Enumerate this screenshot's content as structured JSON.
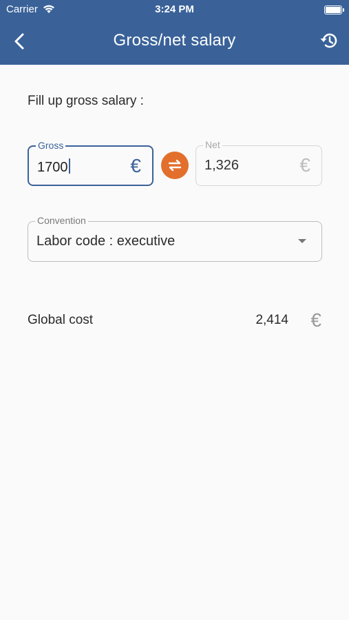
{
  "status_bar": {
    "carrier": "Carrier",
    "time": "3:24 PM"
  },
  "header": {
    "title": "Gross/net salary",
    "back_icon": "chevron-left-icon",
    "reset_icon": "history-reset-icon",
    "background": "#3a6299"
  },
  "form": {
    "prompt": "Fill up gross salary :",
    "gross": {
      "label": "Gross",
      "value": "1700",
      "currency": "€"
    },
    "swap_icon": "swap-arrows-icon",
    "swap_color": "#e36f2c",
    "net": {
      "label": "Net",
      "value": "1,326",
      "currency": "€"
    },
    "convention": {
      "label": "Convention",
      "value": "Labor code : executive"
    }
  },
  "summary": {
    "global_cost_label": "Global cost",
    "global_cost_value": "2,414",
    "currency": "€"
  }
}
